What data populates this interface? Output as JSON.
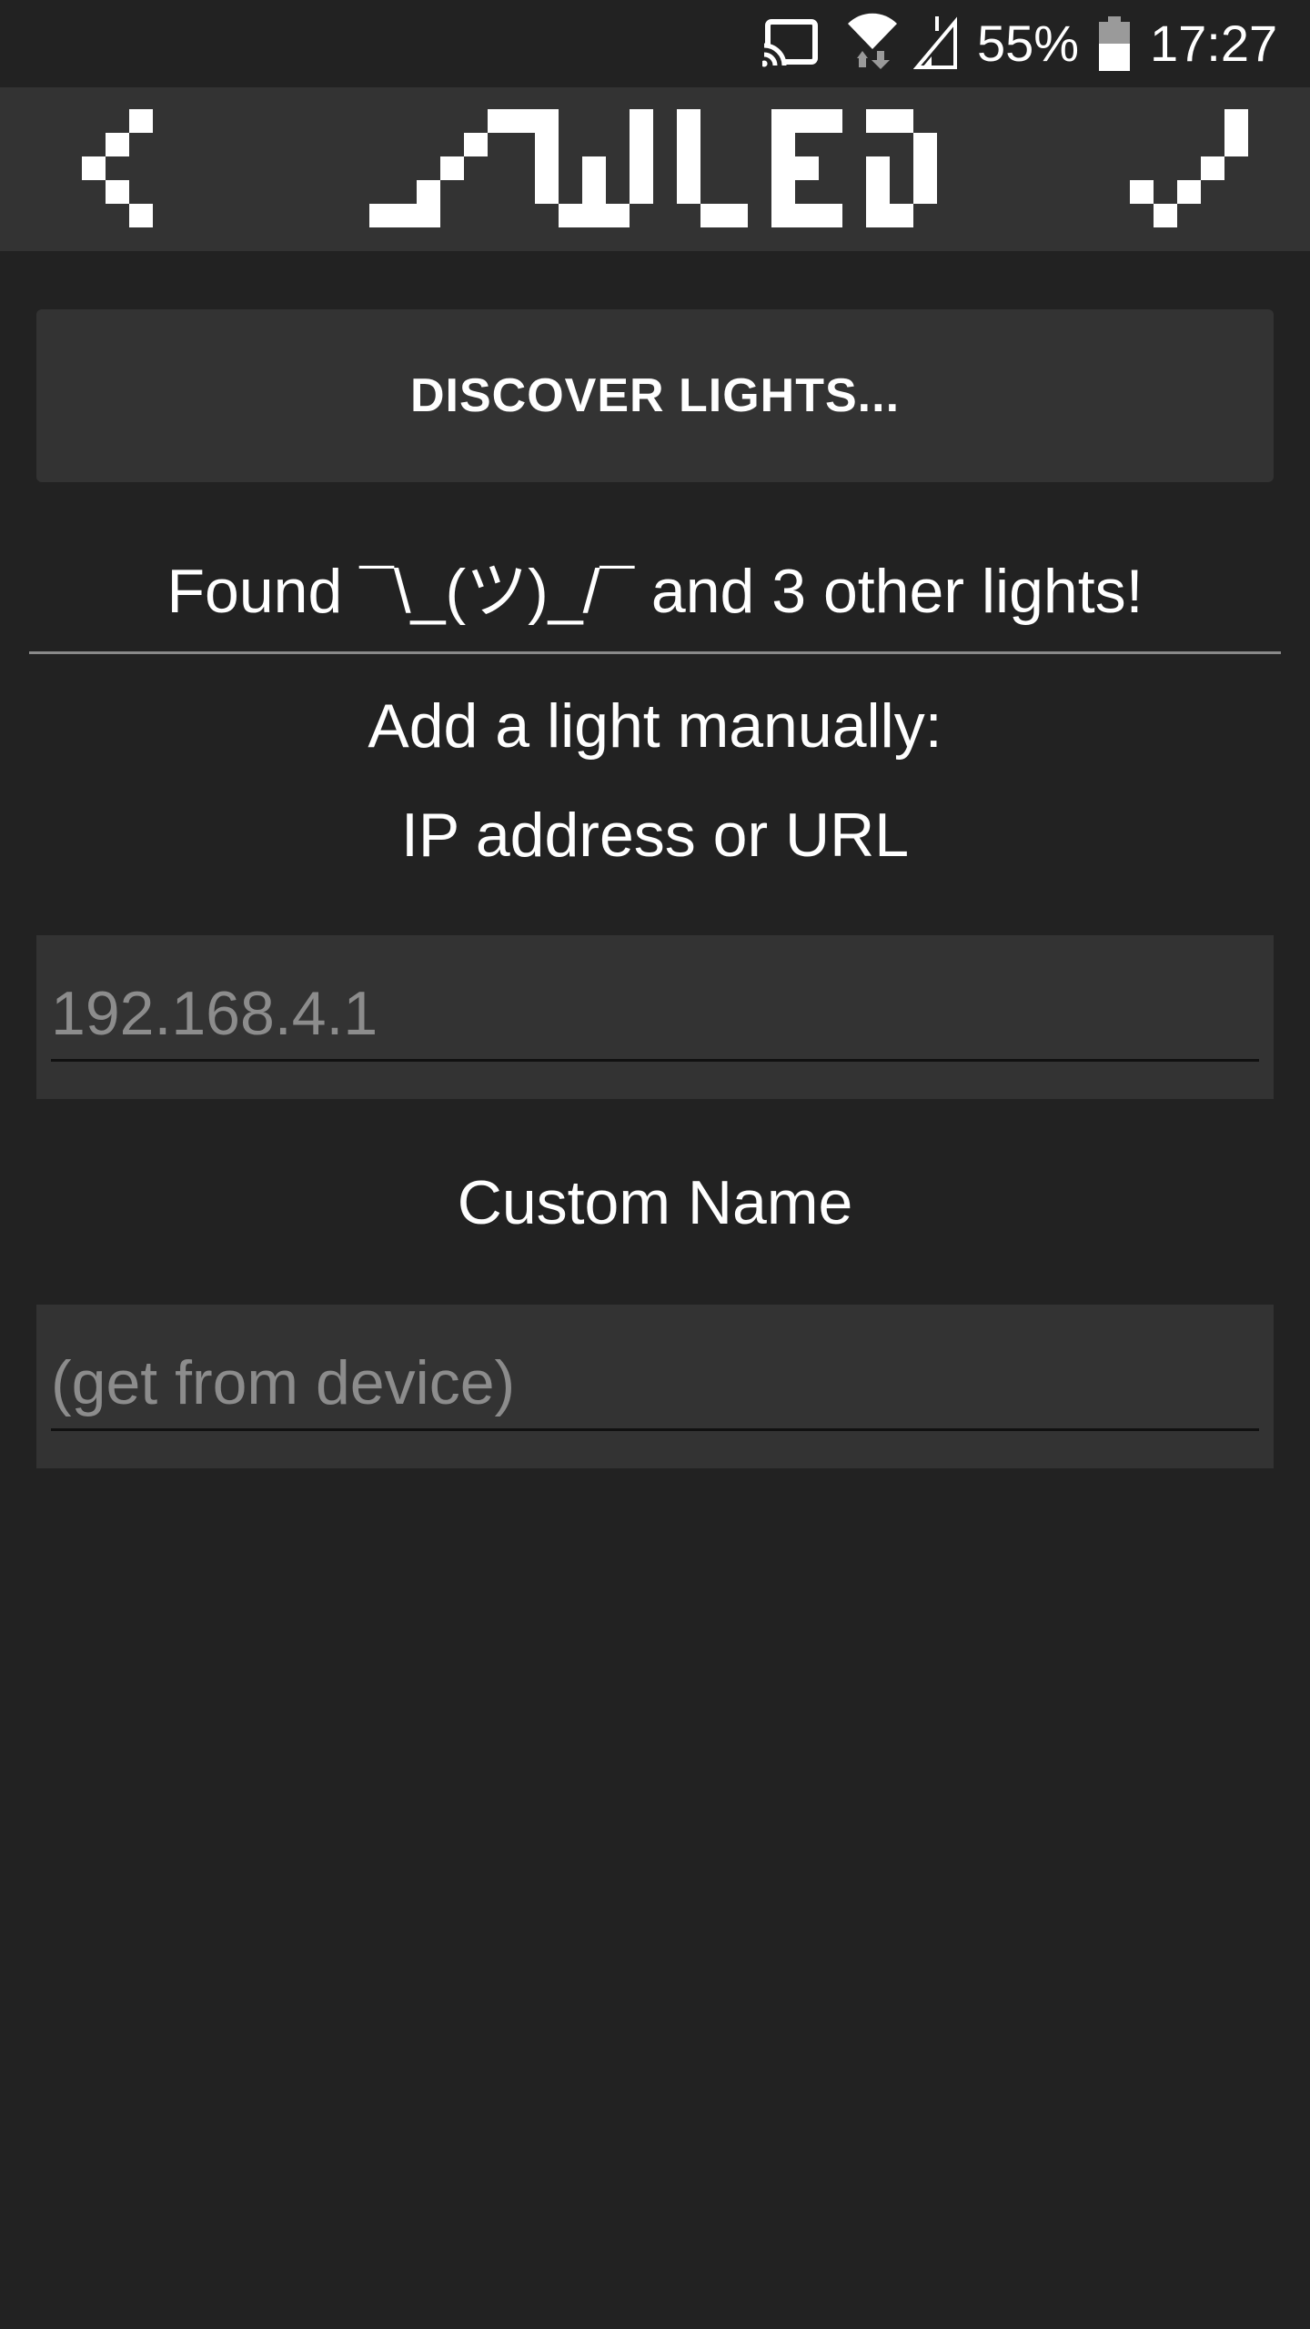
{
  "status_bar": {
    "battery_percent": "55%",
    "time": "17:27",
    "icons": [
      "cast-icon",
      "wifi-icon",
      "signal-icon",
      "battery-icon"
    ]
  },
  "toolbar": {
    "logo_text": "WLED",
    "back_icon": "chevron-left-icon",
    "confirm_icon": "checkmark-icon"
  },
  "discover": {
    "button_label": "DISCOVER LIGHTS..."
  },
  "found": {
    "message": "Found ¯\\_(ツ)_/¯ and 3 other lights!"
  },
  "manual": {
    "heading": "Add a light manually:",
    "ip_label": "IP address or URL",
    "ip_placeholder": "192.168.4.1",
    "ip_value": "",
    "name_label": "Custom Name",
    "name_placeholder": "(get from device)",
    "name_value": ""
  },
  "colors": {
    "background": "#222222",
    "surface": "#333333",
    "text": "#ffffff",
    "placeholder": "#8c8c8c",
    "divider": "#8a8a8a"
  }
}
